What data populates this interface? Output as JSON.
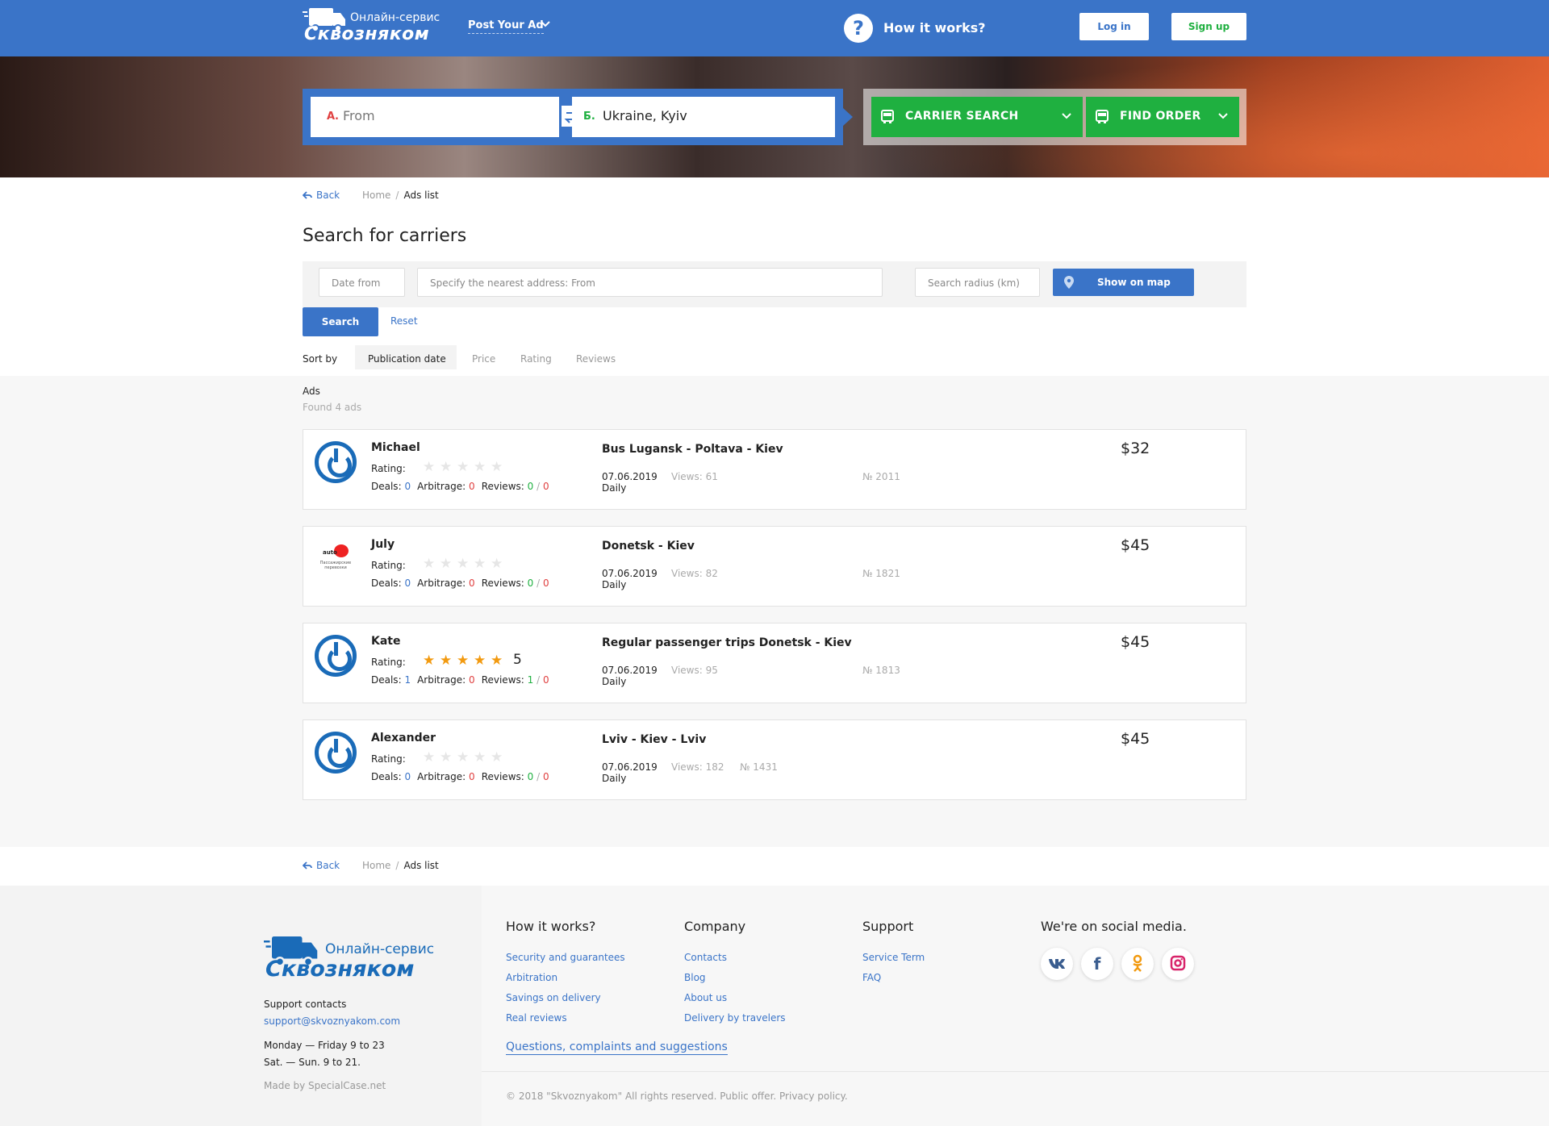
{
  "header": {
    "logo_top": "Онлайн-сервис",
    "logo_main": "Сквознякoм",
    "post_ad": "Post Your Ad",
    "how_it_works": "How it works?",
    "login": "Log in",
    "signup": "Sign up"
  },
  "route": {
    "from_mark": "А.",
    "from_value": "From",
    "to_mark": "Б.",
    "to_value": "Ukraine, Kyiv",
    "carrier_search": "CARRIER SEARCH",
    "find_order": "FIND ORDER"
  },
  "breadcrumbs": {
    "back": "Back",
    "home": "Home",
    "sep": "/",
    "current": "Ads list"
  },
  "page_title": "Search for carriers",
  "filters": {
    "date_placeholder": "Date from",
    "address_placeholder": "Specify the nearest address: From",
    "radius_placeholder": "Search radius (km)",
    "show_on_map": "Show on map",
    "search": "Search",
    "reset": "Reset"
  },
  "sort": {
    "label": "Sort by",
    "options": [
      "Publication date",
      "Price",
      "Rating",
      "Reviews"
    ],
    "active": "Publication date"
  },
  "ads": {
    "title": "Ads",
    "found": "Found 4 ads",
    "labels": {
      "rating": "Rating:",
      "deals": "Deals:",
      "arbitrage": "Arbitrage:",
      "reviews": "Reviews:",
      "slash": "/"
    },
    "items": [
      {
        "name": "Michael",
        "stars": 0,
        "rating_value": "",
        "deals": "0",
        "arbitrage": "0",
        "reviews_pos": "0",
        "reviews_neg": "0",
        "route": "Bus Lugansk - Poltava - Kiev",
        "date": "07.06.2019",
        "views": "Views: 61",
        "number": "№ 2011",
        "frequency": "Daily",
        "price": "$32",
        "avatar": "power-logo"
      },
      {
        "name": "July",
        "stars": 0,
        "rating_value": "",
        "deals": "0",
        "arbitrage": "0",
        "reviews_pos": "0",
        "reviews_neg": "0",
        "route": "Donetsk - Kiev",
        "date": "07.06.2019",
        "views": "Views: 82",
        "number": "№ 1821",
        "frequency": "Daily",
        "price": "$45",
        "avatar": "company-logo"
      },
      {
        "name": "Kate",
        "stars": 5,
        "rating_value": "5",
        "deals": "1",
        "arbitrage": "0",
        "reviews_pos": "1",
        "reviews_neg": "0",
        "route": "Regular passenger trips Donetsk - Kiev",
        "date": "07.06.2019",
        "views": "Views: 95",
        "number": "№ 1813",
        "frequency": "Daily",
        "price": "$45",
        "avatar": "power-logo"
      },
      {
        "name": "Alexander",
        "stars": 0,
        "rating_value": "",
        "deals": "0",
        "arbitrage": "0",
        "reviews_pos": "0",
        "reviews_neg": "0",
        "route": "Lviv - Kiev - Lviv",
        "date": "07.06.2019",
        "views": "Views: 182",
        "number": "№ 1431",
        "frequency": "Daily",
        "price": "$45",
        "avatar": "power-logo"
      }
    ]
  },
  "footer": {
    "logo_top": "Онлайн-сервис",
    "logo_main": "Сквознякoм",
    "support_contacts": "Support contacts",
    "email": "support@skvoznyakom.com",
    "hours_weekday": "Monday — Friday 9 to 23",
    "hours_weekend": "Sat. — Sun. 9 to 21.",
    "made_by": "Made by SpecialCase.net",
    "col_how": {
      "title": "How it works?",
      "links": [
        "Security and guarantees",
        "Arbitration",
        "Savings on delivery",
        "Real reviews"
      ]
    },
    "col_company": {
      "title": "Company",
      "links": [
        "Contacts",
        "Blog",
        "About us",
        "Delivery by travelers"
      ]
    },
    "col_support": {
      "title": "Support",
      "links": [
        "Service Term",
        "FAQ"
      ]
    },
    "social_title": "We're on social media.",
    "social": [
      {
        "icon": "vk-icon",
        "glyph": "vk",
        "color": "#3a5d8f"
      },
      {
        "icon": "facebook-icon",
        "glyph": "f",
        "color": "#3a5d8f"
      },
      {
        "icon": "odnoklassniki-icon",
        "glyph": "ok",
        "color": "#f29a10"
      },
      {
        "icon": "instagram-icon",
        "glyph": "ig",
        "color": "#d8246a"
      }
    ],
    "questions": "Questions, complaints and suggestions",
    "copyright": "© 2018 \"Skvoznyakom\" All rights reserved. Public offer. Privacy policy."
  },
  "colors": {
    "brand_blue": "#3a74c8",
    "green": "#1fb040",
    "red": "#e04040",
    "star": "#f29a10"
  }
}
